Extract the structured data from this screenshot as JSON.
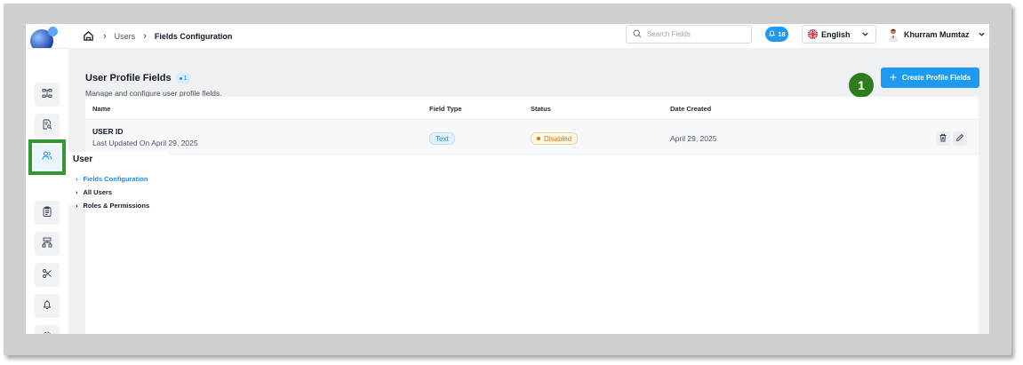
{
  "breadcrumb": {
    "items": [
      "Users",
      "Fields Configuration"
    ]
  },
  "search": {
    "placeholder": "Search Fields"
  },
  "notifications": {
    "count": "18"
  },
  "language": {
    "selected": "English"
  },
  "user": {
    "name": "Khurram Mumtaz"
  },
  "page": {
    "title": "User Profile Fields",
    "count": "1",
    "subtitle": "Manage and configure user profile fields.",
    "create_button": "Create Profile Fields",
    "step_marker": "1"
  },
  "table": {
    "columns": [
      "Name",
      "Field Type",
      "Status",
      "Date Created"
    ],
    "rows": [
      {
        "name": "USER ID",
        "updated": "Last Updated On April 29, 2025",
        "field_type": "Text",
        "status": "Disabled",
        "date_created": "April 29, 2025"
      }
    ]
  },
  "flyout": {
    "title": "User",
    "items": [
      "Fields Configuration",
      "All Users",
      "Roles & Permissions"
    ]
  },
  "colors": {
    "accent": "#1e9bf0",
    "highlight": "#2e9a31",
    "step": "#2e7d1c",
    "warning": "#d97706"
  },
  "icons": {
    "sidebar": [
      "org-chart-icon",
      "document-search-icon",
      "users-icon",
      "clipboard-icon",
      "hierarchy-icon",
      "workflow-icon",
      "bell-icon",
      "gear-icon"
    ]
  }
}
